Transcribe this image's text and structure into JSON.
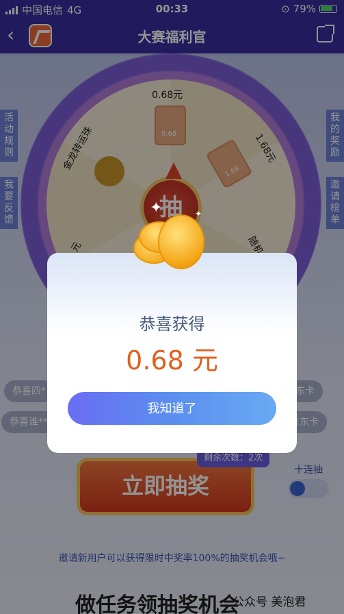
{
  "status": {
    "carrier": "中国电信",
    "network": "4G",
    "time": "00:33",
    "battery": "79%"
  },
  "nav": {
    "title": "大赛福利官"
  },
  "wheel": {
    "hub_label": "抽",
    "prizes": [
      {
        "label": "0.68元"
      },
      {
        "label": "1.68元"
      },
      {
        "label": "金龙转运珠"
      },
      {
        "label": "随机"
      },
      {
        "label": "元"
      }
    ],
    "envelope_value_1": "0.68",
    "envelope_value_2": "1.68"
  },
  "side": {
    "left": [
      {
        "label": "活动规则"
      },
      {
        "label": "我要反馈"
      }
    ],
    "right": [
      {
        "label": "我的奖励"
      },
      {
        "label": "邀请榜单"
      }
    ]
  },
  "tickers": [
    "恭喜四*",
    "恭喜谁**",
    "东卡",
    "京东卡"
  ],
  "draw": {
    "button_label": "立即抽奖",
    "remaining": "剩余次数：2次",
    "ten_draw_label": "十连抽",
    "ten_draw_on": false
  },
  "invite_tip": "邀请新用户可以获得限时中奖率100%的抽奖机会哦~",
  "task_title": "做任务领抽奖机会",
  "watermark": "公众号 美泡君",
  "modal": {
    "title": "恭喜获得",
    "amount": "0.68 元",
    "confirm_label": "我知道了"
  },
  "colors": {
    "accent": "#e0601e",
    "button": "#5a8ff0",
    "nav": "#3a2fa0"
  }
}
